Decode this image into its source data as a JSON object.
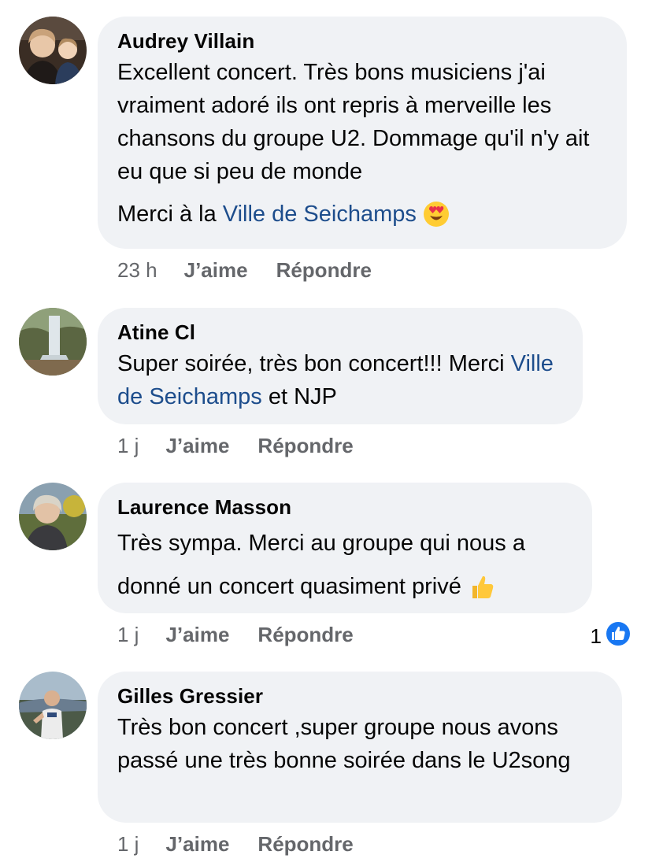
{
  "comments": [
    {
      "author": "Audrey Villain",
      "text_1": "Excellent concert. Très bons musiciens j'ai vraiment adoré ils ont repris à merveille les chansons du groupe U2. Dommage qu'il n'y ait eu que si peu de monde",
      "text_2_prefix": "Merci à la ",
      "text_2_link": "Ville de Seichamps",
      "emoji": "heart-eyes-emoji",
      "time": "23 h",
      "like_label": "J’aime",
      "reply_label": "Répondre"
    },
    {
      "author": "Atine Cl",
      "text_prefix": "Super soirée,  très bon concert!!! Merci ",
      "text_link": "Ville de Seichamps",
      "text_suffix": " et NJP",
      "time": "1 j",
      "like_label": "J’aime",
      "reply_label": "Répondre"
    },
    {
      "author": "Laurence Masson",
      "text": "Très sympa. Merci au groupe qui nous a donné un concert quasiment privé",
      "emoji": "thumbs-up-emoji",
      "time": "1 j",
      "like_label": "J’aime",
      "reply_label": "Répondre",
      "reaction_count": "1",
      "reaction_icon": "like-reaction-icon"
    },
    {
      "author": "Gilles Gressier",
      "text": "Très bon concert ,super groupe nous avons passé une très bonne soirée dans le U2song",
      "time": "1 j",
      "like_label": "J’aime",
      "reply_label": "Répondre"
    }
  ],
  "colors": {
    "bubble": "#f0f2f5",
    "link": "#1d4d8c",
    "meta": "#65676b",
    "like_blue": "#1877f2"
  }
}
